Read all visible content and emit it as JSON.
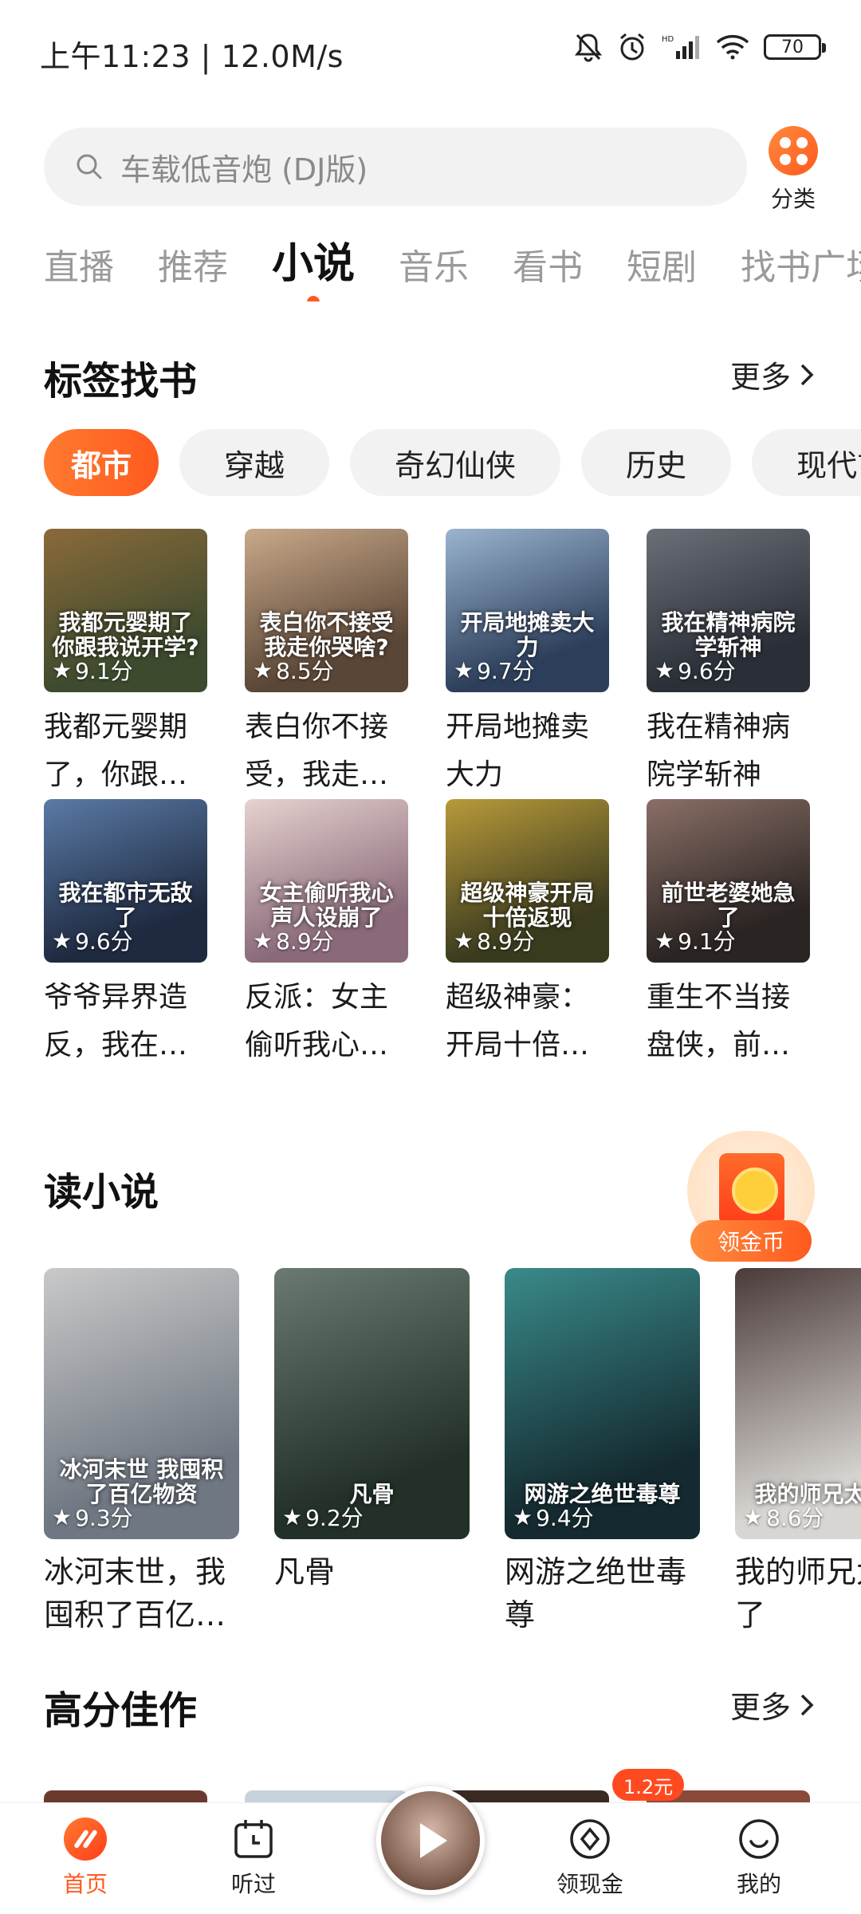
{
  "status_bar": {
    "time_speed": "上午11:23 | 12.0M/s",
    "battery": "70"
  },
  "search": {
    "placeholder": "车载低音炮 (DJ版)",
    "category_label": "分类"
  },
  "tabs": [
    "直播",
    "推荐",
    "小说",
    "音乐",
    "看书",
    "短剧",
    "找书广场"
  ],
  "active_tab": "小说",
  "tag_section": {
    "title": "标签找书",
    "more_label": "更多",
    "chips": [
      "都市",
      "穿越",
      "奇幻仙侠",
      "历史",
      "现代言情"
    ],
    "books": [
      {
        "title": "我都元婴期了，你跟我说开学？",
        "rating": "9.1分",
        "cover_text": "我都元婴期了你跟我说开学?",
        "colors": [
          "#3d4a2e",
          "#8a6a3a"
        ]
      },
      {
        "title": "表白你不接受，我走了你哭啥？",
        "rating": "8.5分",
        "cover_text": "表白你不接受我走你哭啥?",
        "colors": [
          "#5a4636",
          "#c9a98a"
        ]
      },
      {
        "title": "开局地摊卖大力",
        "rating": "9.7分",
        "cover_text": "开局地摊卖大力",
        "colors": [
          "#2c3e5a",
          "#9ab4cf"
        ]
      },
      {
        "title": "我在精神病院学斩神",
        "rating": "9.6分",
        "cover_text": "我在精神病院学斩神",
        "colors": [
          "#2a2e36",
          "#6b6f78"
        ]
      },
      {
        "title": "爷爷异界造反，我在都市无敌了",
        "rating": "9.6分",
        "cover_text": "我在都市无敌了",
        "colors": [
          "#1f2a40",
          "#5a7aa6"
        ]
      },
      {
        "title": "反派：女主偷听我心声人设崩了",
        "rating": "8.9分",
        "cover_text": "女主偷听我心声人设崩了",
        "colors": [
          "#8a6a7a",
          "#e6d2cf"
        ]
      },
      {
        "title": "超级神豪：开局十倍返现",
        "rating": "8.9分",
        "cover_text": "超级神豪开局十倍返现",
        "colors": [
          "#3a3a1e",
          "#b89a3a"
        ]
      },
      {
        "title": "重生不当接盘侠，前世老婆她急了",
        "rating": "9.1分",
        "cover_text": "前世老婆她急了",
        "colors": [
          "#2a2422",
          "#8a6f66"
        ]
      }
    ]
  },
  "read_section": {
    "title": "读小说",
    "novels": [
      {
        "title": "冰河末世，我囤积了百亿物资",
        "rating": "9.3分",
        "cover_text": "冰河末世 我囤积了百亿物资",
        "colors": [
          "#6f7782",
          "#c9c9c9"
        ]
      },
      {
        "title": "凡骨",
        "rating": "9.2分",
        "cover_text": "凡骨",
        "colors": [
          "#223028",
          "#6a7a70"
        ]
      },
      {
        "title": "网游之绝世毒尊",
        "rating": "9.4分",
        "cover_text": "网游之绝世毒尊",
        "colors": [
          "#142a30",
          "#3a8a8a"
        ]
      },
      {
        "title": "我的师兄太强了",
        "rating": "8.6分",
        "cover_text": "我的师兄太强了",
        "colors": [
          "#d8d6d2",
          "#4a3a3a"
        ]
      }
    ]
  },
  "high_score_section": {
    "title": "高分佳作",
    "more_label": "更多",
    "strip_colors": [
      "#6a3a2e",
      "#c8d2dc",
      "#3a2a22",
      "#8a4a3a"
    ]
  },
  "coin_float": {
    "label": "领金币"
  },
  "bottom_nav": {
    "items": [
      "首页",
      "听过",
      "领现金",
      "我的"
    ],
    "cash_badge": "1.2元"
  }
}
